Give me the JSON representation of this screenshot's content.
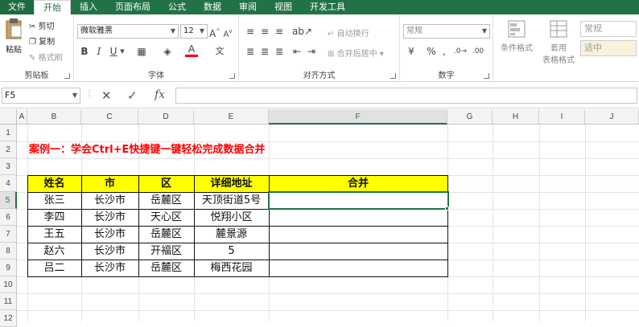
{
  "ribbon_tabs": [
    "文件",
    "开始",
    "插入",
    "页面布局",
    "公式",
    "数据",
    "审阅",
    "视图",
    "开发工具"
  ],
  "clipboard": {
    "paste": "粘贴",
    "cut": "剪切",
    "copy": "复制",
    "format_painter": "格式刷",
    "label": "剪贴板"
  },
  "font": {
    "name": "微软雅黑",
    "size": "12",
    "label": "字体",
    "bold": "B",
    "italic": "I",
    "underline": "U",
    "font_color": "#ff0000"
  },
  "alignment": {
    "wrap": "自动换行",
    "merge": "合并后居中",
    "label": "对齐方式"
  },
  "number": {
    "format": "常规",
    "label": "数字",
    "percent": "%",
    "comma": ","
  },
  "styles": {
    "conditional": "条件格式",
    "table_style_1": "套用",
    "table_style_2": "表格格式",
    "normal": "常规",
    "medium": "适中"
  },
  "formula_bar": {
    "name_box": "F5",
    "fx": "fx",
    "cancel": "✕",
    "confirm": "✓",
    "value": ""
  },
  "columns": [
    "A",
    "B",
    "C",
    "D",
    "E",
    "F",
    "G",
    "H",
    "I",
    "J"
  ],
  "rows": [
    "1",
    "2",
    "3",
    "4",
    "5",
    "6",
    "7",
    "8",
    "9",
    "10",
    "11",
    "12"
  ],
  "title": "案例一：学会Ctrl+E快捷键一键轻松完成数据合并",
  "table": {
    "headers": [
      "姓名",
      "市",
      "区",
      "详细地址",
      "合并"
    ],
    "rows": [
      [
        "张三",
        "长沙市",
        "岳麓区",
        "天顶街道5号",
        ""
      ],
      [
        "李四",
        "长沙市",
        "天心区",
        "悦翔小区",
        ""
      ],
      [
        "王五",
        "长沙市",
        "岳麓区",
        "麓景源",
        ""
      ],
      [
        "赵六",
        "长沙市",
        "开福区",
        "5",
        ""
      ],
      [
        "吕二",
        "长沙市",
        "岳麓区",
        "梅西花园",
        ""
      ]
    ]
  },
  "selected_cell": "F5",
  "colors": {
    "accent": "#217346",
    "header_fill": "#ffff00",
    "title": "#ff0000"
  }
}
